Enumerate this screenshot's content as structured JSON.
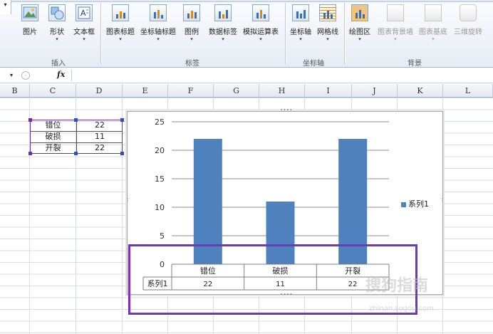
{
  "ribbon": {
    "insert_group": {
      "label": "插入",
      "buttons": [
        {
          "label": "图片",
          "icon": "picture-icon"
        },
        {
          "label": "形状",
          "icon": "shapes-icon"
        },
        {
          "label": "文本框",
          "icon": "textbox-icon"
        }
      ]
    },
    "labels_group": {
      "label": "标签",
      "buttons": [
        {
          "label": "图表标题",
          "icon": "chart-title-icon"
        },
        {
          "label": "坐标轴标题",
          "icon": "axis-title-icon"
        },
        {
          "label": "图例",
          "icon": "legend-icon"
        },
        {
          "label": "数据标签",
          "icon": "data-labels-icon"
        },
        {
          "label": "模拟运算表",
          "icon": "data-table-icon"
        }
      ]
    },
    "axes_group": {
      "label": "坐标轴",
      "buttons": [
        {
          "label": "坐标轴",
          "icon": "axes-icon"
        },
        {
          "label": "网格线",
          "icon": "gridlines-icon"
        }
      ]
    },
    "background_group": {
      "label": "背景",
      "buttons": [
        {
          "label": "绘图区",
          "icon": "plot-area-icon",
          "enabled": true
        },
        {
          "label": "图表背景墙",
          "icon": "chart-wall-icon",
          "enabled": false
        },
        {
          "label": "图表基底",
          "icon": "chart-floor-icon",
          "enabled": false
        },
        {
          "label": "三维旋转",
          "icon": "3d-rotation-icon",
          "enabled": false
        }
      ]
    }
  },
  "formula_bar": {
    "fx_label": "fx",
    "value": ""
  },
  "columns": [
    "B",
    "C",
    "D",
    "E",
    "F",
    "G",
    "H",
    "I",
    "J",
    "K",
    "L"
  ],
  "sheet": {
    "rows": [
      {
        "label": "错位",
        "value": "22"
      },
      {
        "label": "破损",
        "value": "11"
      },
      {
        "label": "开裂",
        "value": "22"
      }
    ]
  },
  "chart_data": {
    "type": "bar",
    "categories": [
      "错位",
      "破损",
      "开裂"
    ],
    "series": [
      {
        "name": "系列1",
        "values": [
          22,
          11,
          22
        ],
        "color": "#4f81bd"
      }
    ],
    "yticks": [
      "0",
      "5",
      "10",
      "15",
      "20",
      "25"
    ],
    "ylim": [
      0,
      25
    ],
    "legend": "right",
    "data_table": true,
    "table_values": [
      "22",
      "11",
      "22"
    ]
  },
  "watermark": {
    "text": "搜狗指南",
    "url": "zhinan.sogou.com"
  }
}
